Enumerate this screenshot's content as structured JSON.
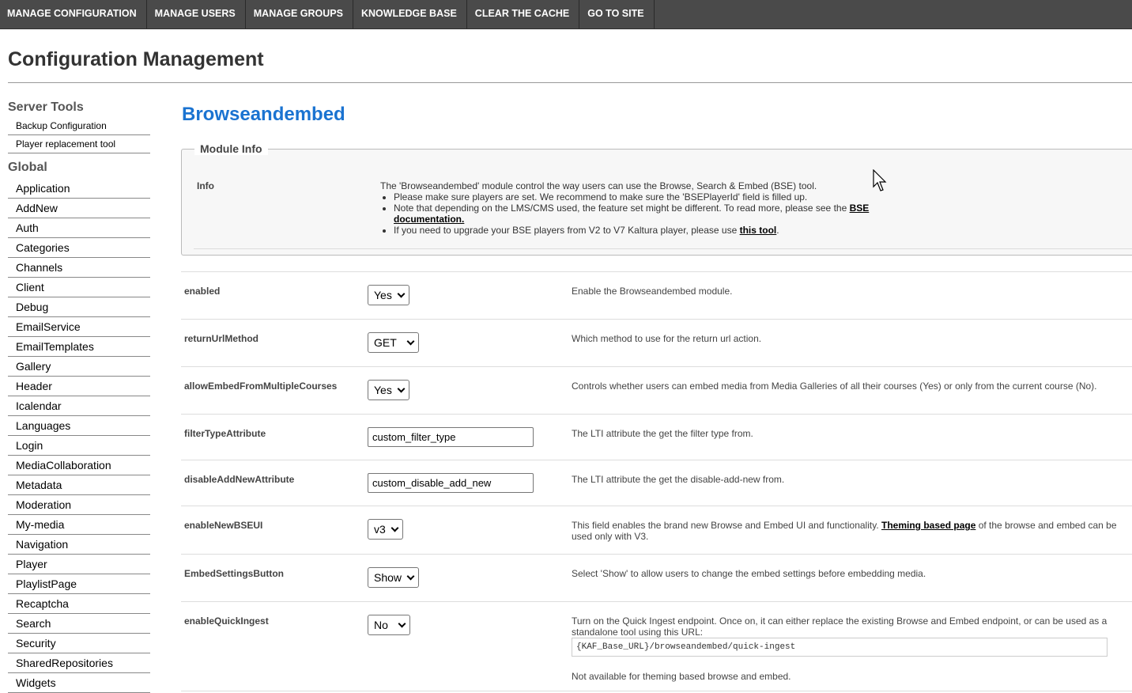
{
  "nav": [
    "MANAGE CONFIGURATION",
    "MANAGE USERS",
    "MANAGE GROUPS",
    "KNOWLEDGE BASE",
    "CLEAR THE CACHE",
    "GO TO SITE"
  ],
  "page_title": "Configuration Management",
  "sidebar": {
    "server_tools_heading": "Server Tools",
    "server_tools": [
      "Backup Configuration",
      "Player replacement tool"
    ],
    "global_heading": "Global",
    "global_items": [
      "Application",
      "AddNew",
      "Auth",
      "Categories",
      "Channels",
      "Client",
      "Debug",
      "EmailService",
      "EmailTemplates",
      "Gallery",
      "Header",
      "Icalendar",
      "Languages",
      "Login",
      "MediaCollaboration",
      "Metadata",
      "Moderation",
      "My-media",
      "Navigation",
      "Player",
      "PlaylistPage",
      "Recaptcha",
      "Search",
      "Security",
      "SharedRepositories",
      "Widgets"
    ]
  },
  "module": {
    "title": "Browseandembed",
    "info_legend": "Module Info",
    "info_label": "Info",
    "info_intro": "The 'Browseandembed' module control the way users can use the Browse, Search & Embed (BSE) tool.",
    "bullet1": "Please make sure players are set. We recommend to make sure the 'BSEPlayerId' field is filled up.",
    "bullet2_text": "Note that depending on the LMS/CMS used, the feature set might be different. To read more, please see the ",
    "bullet2_link": "BSE documentation.",
    "bullet3_text": "If you need to upgrade your BSE players from V2 to V7 Kaltura player, please use ",
    "bullet3_link": "this tool",
    "bullet3_end": "."
  },
  "settings": {
    "enabled": {
      "label": "enabled",
      "value": "Yes",
      "desc": "Enable the Browseandembed module."
    },
    "returnUrlMethod": {
      "label": "returnUrlMethod",
      "value": "GET",
      "desc": "Which method to use for the return url action."
    },
    "allowEmbedFromMultipleCourses": {
      "label": "allowEmbedFromMultipleCourses",
      "value": "Yes",
      "desc": "Controls whether users can embed media from Media Galleries of all their courses (Yes) or only from the current course (No)."
    },
    "filterTypeAttribute": {
      "label": "filterTypeAttribute",
      "value": "custom_filter_type",
      "desc": "The LTI attribute the get the filter type from."
    },
    "disableAddNewAttribute": {
      "label": "disableAddNewAttribute",
      "value": "custom_disable_add_new",
      "desc": "The LTI attribute the get the disable-add-new from."
    },
    "enableNewBSEUI": {
      "label": "enableNewBSEUI",
      "value": "v3",
      "desc_pre": "This field enables the brand new Browse and Embed UI and functionality. ",
      "desc_link": "Theming based page",
      "desc_post": " of the browse and embed can be used only with V3."
    },
    "EmbedSettingsButton": {
      "label": "EmbedSettingsButton",
      "value": "Show",
      "desc": "Select 'Show' to allow users to change the embed settings before embedding media."
    },
    "enableQuickIngest": {
      "label": "enableQuickIngest",
      "value": "No",
      "desc": "Turn on the Quick Ingest endpoint. Once on, it can either replace the existing Browse and Embed endpoint, or can be used as a standalone tool using this URL:",
      "url": "{KAF_Base_URL}/browseandembed/quick-ingest",
      "note": "Not available for theming based browse and embed."
    }
  }
}
